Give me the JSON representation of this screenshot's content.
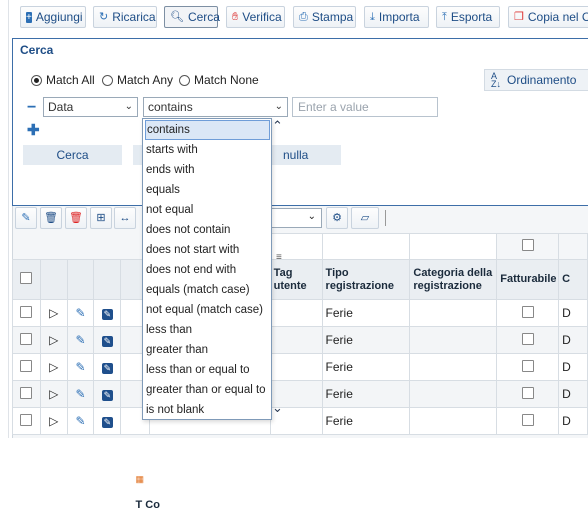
{
  "toolbar": {
    "buttons": [
      {
        "label": "Aggiungi",
        "icon": "plus-square-icon"
      },
      {
        "label": "Ricarica",
        "icon": "refresh-icon"
      },
      {
        "label": "Cerca",
        "icon": "search-icon"
      },
      {
        "label": "Verifica",
        "icon": "thumbs-up-icon"
      },
      {
        "label": "Stampa",
        "icon": "print-icon"
      },
      {
        "label": "Importa",
        "icon": "download-icon"
      },
      {
        "label": "Esporta",
        "icon": "upload-icon"
      },
      {
        "label": "Copia nel Cl",
        "icon": "copy-icon"
      }
    ]
  },
  "search": {
    "title": "Cerca",
    "match_all": "Match All",
    "match_any": "Match Any",
    "match_none": "Match None",
    "ordering": "Ordinamento",
    "field": "Data",
    "operator": "contains",
    "value_placeholder": "Enter a value",
    "search_button": "Cerca",
    "cancel_button_partial": "nulla"
  },
  "operators": [
    "contains",
    "starts with",
    "ends with",
    "equals",
    "not equal",
    "does not contain",
    "does not start with",
    "does not end with",
    "equals (match case)",
    "not equal (match case)",
    "less than",
    "greater than",
    "less than or equal to",
    "greater than or equal to",
    "is not blank"
  ],
  "grid": {
    "headers": {
      "col_t_partial": "T Co",
      "tag_utente": "Tag utente",
      "tipo_registrazione": "Tipo registrazione",
      "categoria": "Categoria della registrazione",
      "fatturabile": "Fatturabile",
      "last_partial": "C"
    },
    "rows": [
      {
        "tipo": "Ferie",
        "last": "D"
      },
      {
        "tipo": "Ferie",
        "last": "D"
      },
      {
        "tipo": "Ferie",
        "last": "D"
      },
      {
        "tipo": "Ferie",
        "last": "D"
      },
      {
        "tipo": "Ferie",
        "last": "D"
      }
    ]
  }
}
